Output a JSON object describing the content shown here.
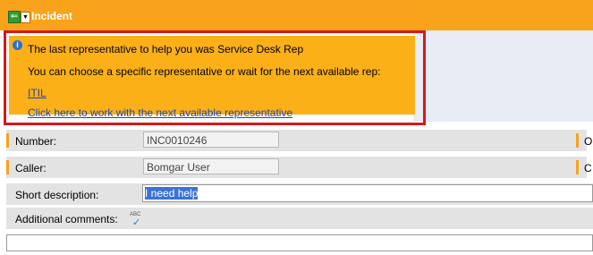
{
  "header": {
    "title": "Incident",
    "back_symbol": "⇐",
    "menu_symbol": "▼",
    "color": "#f8a31b"
  },
  "notice": {
    "line1": "The last representative to help you was Service Desk Rep",
    "line2": "You can choose a specific representative or wait for the next available rep:",
    "link1": "ITIL",
    "link2": "Click here to work with the next available representative",
    "info_symbol": "i",
    "highlight_border": "#d8171b"
  },
  "form": {
    "number": {
      "label": "Number:",
      "value": "INC0010246"
    },
    "caller": {
      "label": "Caller:",
      "value": "Bomgar User"
    },
    "short_description": {
      "label": "Short description:",
      "value": "I need help"
    },
    "additional_comments": {
      "label": "Additional comments:",
      "spell_text": "ABC",
      "spell_check": "✓"
    },
    "right_labels": [
      "O",
      "C"
    ]
  }
}
